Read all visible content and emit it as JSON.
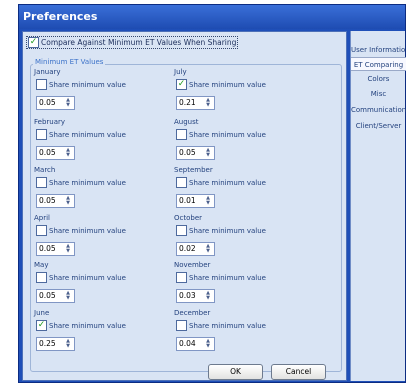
{
  "window": {
    "title": "Preferences"
  },
  "top_option": {
    "label": "Compare Against Minimum ET Values When Sharing",
    "checked": true
  },
  "group": {
    "title": "Minimum ET Values"
  },
  "share_label": "Share minimum value",
  "months": [
    {
      "name": "January",
      "share": false,
      "value": "0.05"
    },
    {
      "name": "February",
      "share": false,
      "value": "0.05"
    },
    {
      "name": "March",
      "share": false,
      "value": "0.05"
    },
    {
      "name": "April",
      "share": false,
      "value": "0.05"
    },
    {
      "name": "May",
      "share": false,
      "value": "0.05"
    },
    {
      "name": "June",
      "share": true,
      "value": "0.25"
    },
    {
      "name": "July",
      "share": true,
      "value": "0.21"
    },
    {
      "name": "August",
      "share": false,
      "value": "0.05"
    },
    {
      "name": "September",
      "share": false,
      "value": "0.01"
    },
    {
      "name": "October",
      "share": false,
      "value": "0.02"
    },
    {
      "name": "November",
      "share": false,
      "value": "0.03"
    },
    {
      "name": "December",
      "share": false,
      "value": "0.04"
    }
  ],
  "buttons": {
    "ok": "OK",
    "cancel": "Cancel"
  },
  "nav": {
    "items": [
      {
        "label": "User Information",
        "active": false
      },
      {
        "label": "ET Comparing",
        "active": true
      },
      {
        "label": "Colors",
        "active": false
      },
      {
        "label": "Misc",
        "active": false
      },
      {
        "label": "Communications",
        "active": false
      },
      {
        "label": "Client/Server",
        "active": false
      }
    ]
  },
  "colors": {
    "title_bar": "#1f4fb8",
    "panel_background": "#d9e4f4",
    "text": "#24427e",
    "check_mark": "#1d9a1d",
    "active_nav": "#f7f8ff"
  },
  "icons": {
    "check": "check-icon",
    "spin_up": "arrow-up-icon",
    "spin_down": "arrow-down-icon"
  }
}
